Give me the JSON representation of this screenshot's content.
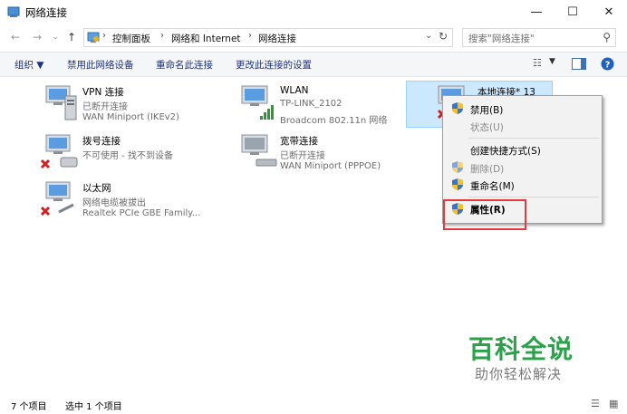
{
  "window": {
    "title": "网络连接"
  },
  "address": {
    "crumbs": [
      "控制面板",
      "网络和 Internet",
      "网络连接"
    ],
    "search_placeholder": "搜索\"网络连接\""
  },
  "toolbar": {
    "organize": "组织 ▼",
    "disable": "禁用此网络设备",
    "rename": "重命名此连接",
    "change_settings": "更改此连接的设置"
  },
  "connections": [
    {
      "name": "VPN 连接",
      "status": "已断开连接",
      "device": "WAN Miniport (IKEv2)"
    },
    {
      "name": "WLAN",
      "status": "TP-LINK_2102",
      "device": "Broadcom 802.11n 网络"
    },
    {
      "name": "本地连接* 13",
      "status": "",
      "device": ""
    },
    {
      "name": "拨号连接",
      "status": "不可使用 - 找不到设备",
      "device": ""
    },
    {
      "name": "宽带连接",
      "status": "已断开连接",
      "device": "WAN Miniport (PPPOE)"
    },
    {
      "name": "以太网",
      "status": "网络电缆被拔出",
      "device": "Realtek PCIe GBE Family..."
    }
  ],
  "context_menu": {
    "disable": "禁用(B)",
    "status": "状态(U)",
    "create_shortcut": "创建快捷方式(S)",
    "delete": "删除(D)",
    "rename": "重命名(M)",
    "properties": "属性(R)"
  },
  "statusbar": {
    "count": "7 个项目",
    "selected": "选中 1 个项目"
  },
  "watermark": {
    "main": "百科全说",
    "sub": "助你轻松解决"
  },
  "colors": {
    "accent": "#1e3287",
    "selection": "#cce8ff",
    "highlight_box": "#e23b3b",
    "watermark": "#2aa24a"
  }
}
